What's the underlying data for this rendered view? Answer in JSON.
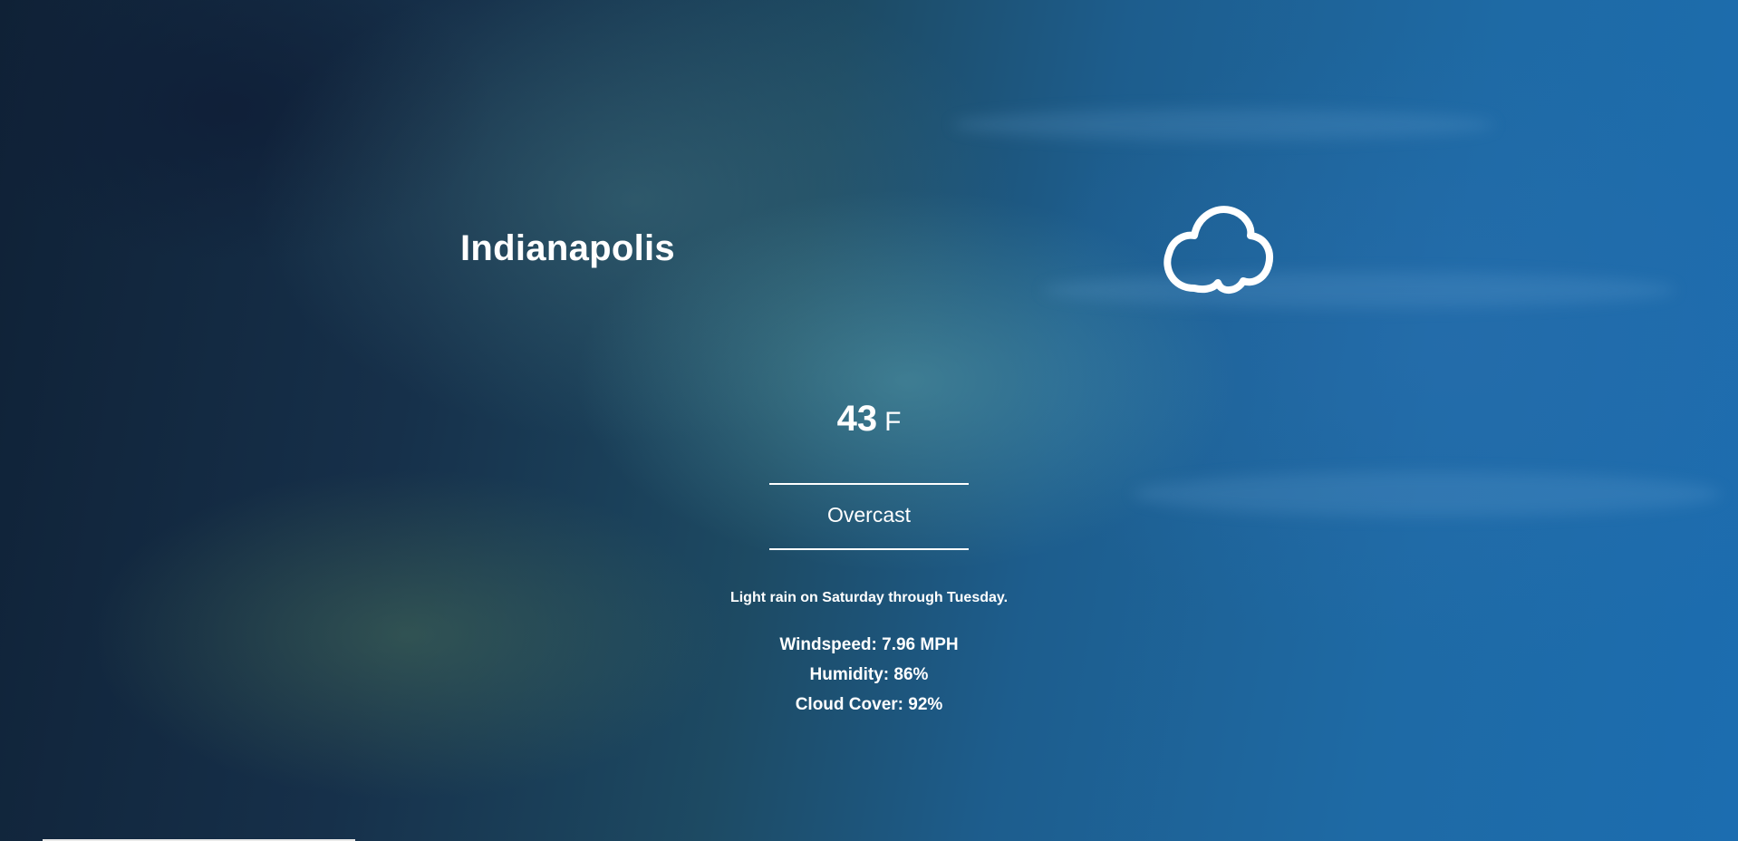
{
  "location": {
    "city": "Indianapolis"
  },
  "current": {
    "temperature": "43",
    "unit": "F",
    "summary": "Overcast",
    "icon": "cloud-icon"
  },
  "forecast": "Light rain on Saturday through Tuesday.",
  "details": {
    "windspeed": "Windspeed: 7.96 MPH",
    "humidity": "Humidity: 86%",
    "cloud_cover": "Cloud Cover: 92%"
  },
  "colors": {
    "text": "#ffffff",
    "sky_blue": "#1c6db0",
    "storm_dark": "#0f2136"
  }
}
